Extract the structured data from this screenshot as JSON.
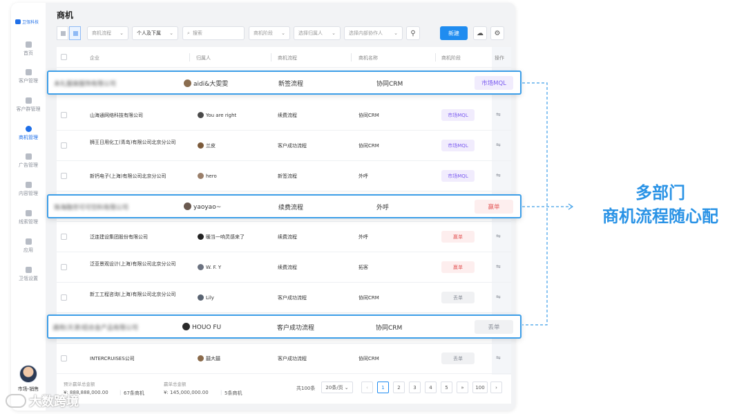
{
  "app": {
    "brand": "卫瓴科技",
    "user_name": "市场-销售",
    "colors": {
      "accent": "#1f8cf0",
      "highlight_border": "#3c9ee8",
      "promo": "#2a93e6"
    }
  },
  "sidebar": {
    "items": [
      {
        "label": "首页",
        "icon": "home-icon"
      },
      {
        "label": "客户管理",
        "icon": "customer-icon"
      },
      {
        "label": "客户群管理",
        "icon": "group-icon"
      },
      {
        "label": "商机管理",
        "icon": "opportunity-icon",
        "active": true
      },
      {
        "label": "广告管理",
        "icon": "ad-icon"
      },
      {
        "label": "内容管理",
        "icon": "content-icon"
      },
      {
        "label": "线索管理",
        "icon": "lead-icon"
      },
      {
        "label": "应用",
        "icon": "apps-icon"
      },
      {
        "label": "卫瓴设置",
        "icon": "settings-icon"
      }
    ]
  },
  "page": {
    "title": "商机"
  },
  "toolbar": {
    "process_filter": "商机流程",
    "owner_filter": "个人及下属",
    "search_placeholder": "搜索",
    "stage_filter": "商机阶段",
    "assignee_filter": "选择归属人",
    "collaborator_filter": "选择内部协作人",
    "new_label": "新建"
  },
  "table": {
    "headers": [
      "企业",
      "归属人",
      "商机流程",
      "商机名称",
      "商机阶段",
      "操作"
    ],
    "rows": [
      {
        "company": "山海通网络科技有限公司",
        "owner": "You are right",
        "process": "续费流程",
        "name": "协同CRM",
        "stage": "市场MQL",
        "stage_type": "mql"
      },
      {
        "company": "狮王日用化工(青岛)有限公司北京分公司",
        "owner": "兰皮",
        "process": "客户成功流程",
        "name": "协同CRM",
        "stage": "市场MQL",
        "stage_type": "mql"
      },
      {
        "company": "新钙电子(上海)有限公司北京分公司",
        "owner": "hero",
        "process": "新签流程",
        "name": "外呼",
        "stage": "市场MQL",
        "stage_type": "mql"
      },
      {
        "company": "泛连建设集团股份有限公司",
        "owner": "暖当一响灵感来了",
        "process": "续费流程",
        "name": "外呼",
        "stage": "赢单",
        "stage_type": "win"
      },
      {
        "company": "泛亚景观设计(上海)有限公司北京分公司",
        "owner": "W. F. Y",
        "process": "续费流程",
        "name": "拓客",
        "stage": "赢单",
        "stage_type": "win"
      },
      {
        "company": "新工工程咨询(上海)有限公司北京分公司",
        "owner": "Lily",
        "process": "客户成功流程",
        "name": "协同CRM",
        "stage": "丢单",
        "stage_type": "lost"
      },
      {
        "company": "INTERCRUISES公司",
        "owner": "囍大囍",
        "process": "客户成功流程",
        "name": "协同CRM",
        "stage": "丢单",
        "stage_type": "lost"
      }
    ]
  },
  "highlights": [
    {
      "company": "未礼服装服饰有限公司",
      "owner": "aidi&大雯雯",
      "process": "新签流程",
      "name": "协同CRM",
      "stage": "市场MQL",
      "stage_type": "mql"
    },
    {
      "company": "珠海融世可可饮料有限公司",
      "owner": "yaoyao~",
      "process": "续费流程",
      "name": "外呼",
      "stage": "赢单",
      "stage_type": "win"
    },
    {
      "company": "通用(天津)铝合金产品有限公司",
      "owner": "HOUO FU",
      "process": "客户成功流程",
      "name": "协同CRM",
      "stage": "丢单",
      "stage_type": "lost"
    }
  ],
  "footer": {
    "forecast_label": "预计赢单总金额",
    "forecast_value": "¥: 888,888,000.00",
    "forecast_count": "67条商机",
    "won_label": "赢单总金额",
    "won_value": "¥: 145,000,000.00",
    "won_count": "5条商机",
    "total": "共100条",
    "page_size": "20条/页",
    "pages": [
      "1",
      "2",
      "3",
      "4",
      "5",
      "»",
      "100"
    ],
    "current_page": "1"
  },
  "promo": {
    "line1": "多部门",
    "line2": "商机流程随心配"
  },
  "watermark": "大数跨境"
}
